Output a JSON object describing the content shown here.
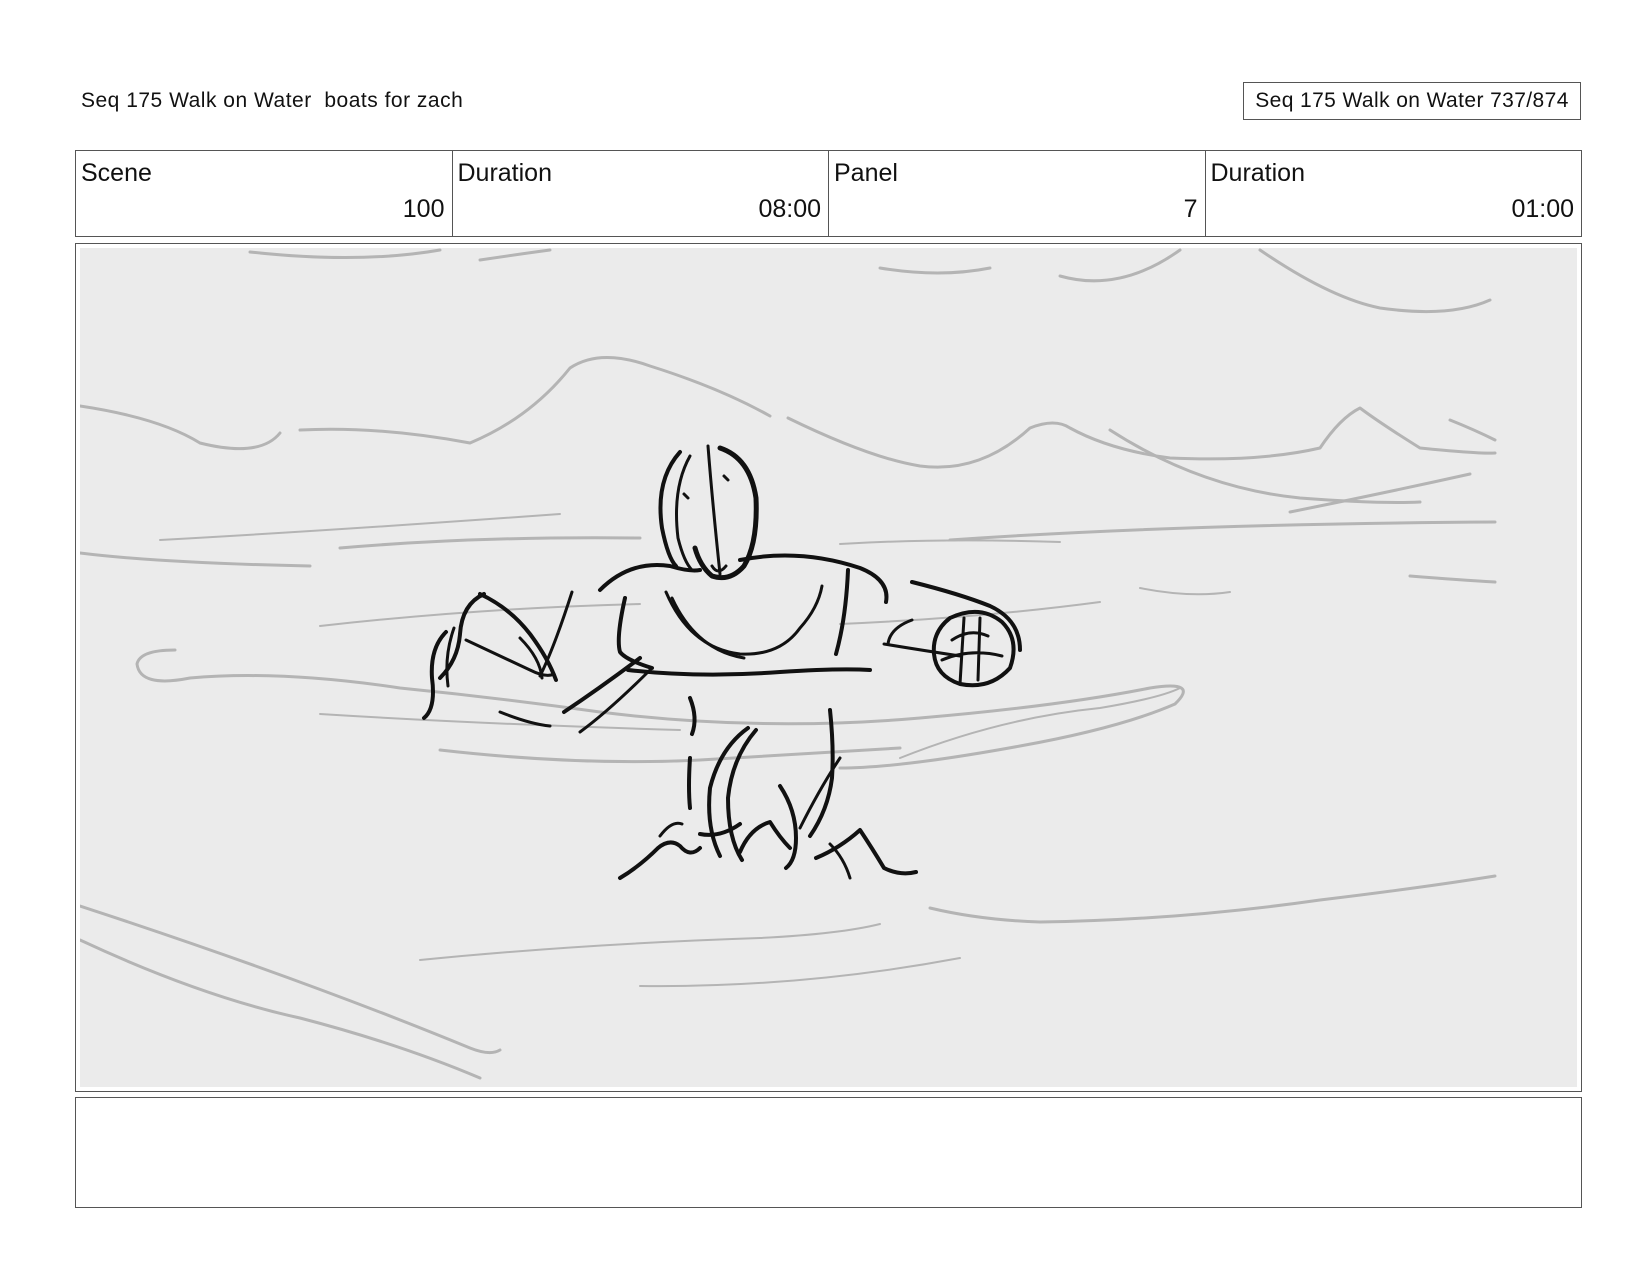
{
  "header": {
    "sequence_title": "Seq 175 Walk on Water  boats for zach",
    "page_counter": "Seq 175 Walk on Water 737/874"
  },
  "info": {
    "scene_label": "Scene",
    "scene_value": "100",
    "scene_duration_label": "Duration",
    "scene_duration_value": "08:00",
    "panel_label": "Panel",
    "panel_value": "7",
    "panel_duration_label": "Duration",
    "panel_duration_value": "01:00"
  },
  "panel": {
    "background_color": "#ebebeb",
    "water_stroke_color": "#b4b4b4",
    "figure_stroke_color": "#111111"
  },
  "notes": {
    "text": ""
  }
}
